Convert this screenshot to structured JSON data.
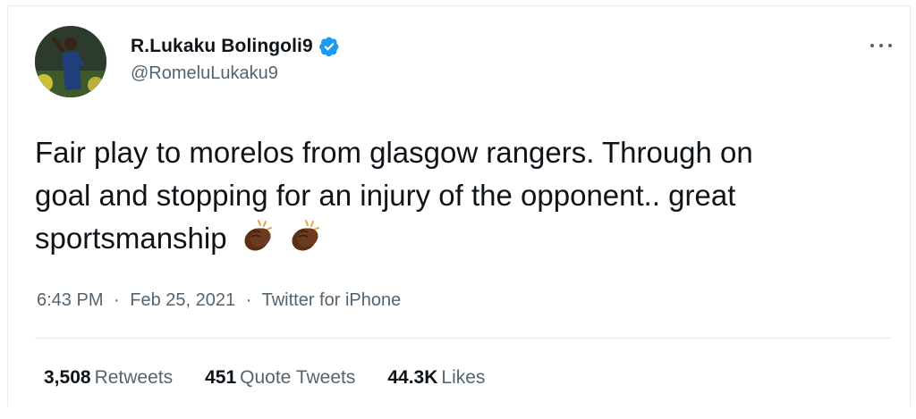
{
  "tweet": {
    "author": {
      "display_name": "R.Lukaku Bolingoli9",
      "handle": "@RomeluLukaku9",
      "verified": true,
      "avatar_icon": "profile-photo"
    },
    "more_icon": "more-horizontal-icon",
    "text": {
      "line1": "Fair play to morelos from glasgow rangers. Through on",
      "line2": "goal and stopping for an injury of the opponent.. great",
      "line3": "sportsmanship",
      "emoji": [
        "clapping-hands-icon",
        "clapping-hands-icon"
      ]
    },
    "meta": {
      "time": "6:43 PM",
      "separator": "·",
      "date": "Feb 25, 2021",
      "source": "Twitter for iPhone"
    },
    "stats": {
      "retweets_count": "3,508",
      "retweets_label": "Retweets",
      "quotes_count": "451",
      "quotes_label": "Quote Tweets",
      "likes_count": "44.3K",
      "likes_label": "Likes"
    },
    "colors": {
      "verified_blue": "#1d9bf0",
      "secondary_text": "#536471",
      "primary_text": "#0f1419",
      "divider": "#e6ecf0",
      "clap_skin": "#6b3a1f"
    }
  }
}
